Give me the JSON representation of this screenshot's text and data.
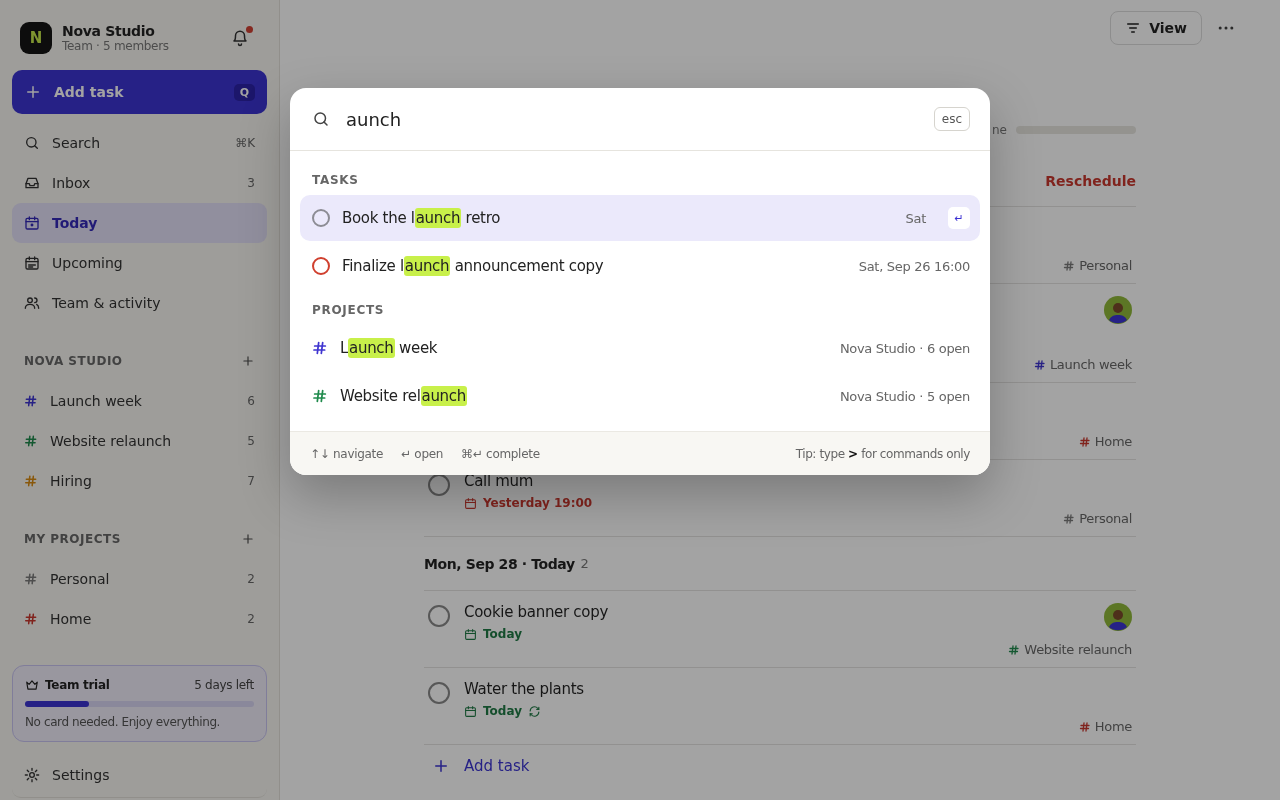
{
  "sidebar": {
    "workspace": {
      "logo": "N",
      "name": "Nova Studio",
      "subtitle": "Team · 5 members",
      "has_notification": true
    },
    "add_task": {
      "label": "Add task",
      "shortcut": "Q"
    },
    "nav": [
      {
        "kind": "search",
        "label": "Search",
        "badge": "⌘K",
        "selected": false
      },
      {
        "kind": "inbox",
        "label": "Inbox",
        "badge": "3",
        "selected": false
      },
      {
        "kind": "today",
        "label": "Today",
        "selected": true
      },
      {
        "kind": "upcoming",
        "label": "Upcoming",
        "selected": false
      },
      {
        "kind": "team",
        "label": "Team & activity",
        "selected": false
      }
    ],
    "sections": [
      {
        "title": "NOVA STUDIO",
        "projects": [
          {
            "name": "Launch week",
            "count": "6",
            "color": "#282285"
          },
          {
            "name": "Website relaunch",
            "count": "5",
            "color": "#145831"
          },
          {
            "name": "Hiring",
            "count": "7",
            "color": "#89580b"
          }
        ]
      },
      {
        "title": "MY PROJECTS",
        "projects": [
          {
            "name": "Personal",
            "count": "2",
            "color": "#4e4e4e"
          },
          {
            "name": "Home",
            "count": "2",
            "color": "#80231d"
          }
        ]
      }
    ],
    "trial": {
      "title": "Team trial",
      "remaining": "5 days left",
      "level": 0.28,
      "note": "No card needed. Enjoy everything."
    },
    "settings": {
      "label": "Settings"
    }
  },
  "main": {
    "view_button": "View",
    "progress": {
      "label": "ne",
      "level": 0
    },
    "groups": [
      {
        "action": "Reschedule",
        "tasks": [
          {
            "tag": "Personal",
            "color": "#4e4e4e"
          },
          {
            "avatar": true,
            "tag": "Launch week",
            "color": "#282285"
          },
          {
            "tag": "Home",
            "color": "#80231d"
          },
          {
            "title": "Call mum",
            "checked": false,
            "due": "Yesterday 19:00",
            "overdue": true,
            "tag": "Personal",
            "color": "#4e4e4e"
          }
        ]
      },
      {
        "title": "Mon, Sep 28 · Today",
        "count": "2",
        "tasks": [
          {
            "title": "Cookie banner copy",
            "checked": false,
            "due": "Today",
            "overdue": false,
            "avatar": true,
            "tag": "Website relaunch",
            "color": "#145831"
          },
          {
            "title": "Water the plants",
            "checked": false,
            "due": "Today",
            "overdue": false,
            "recurring": true,
            "tag": "Home",
            "color": "#80231d"
          }
        ]
      }
    ],
    "add_task": "Add task"
  },
  "palette": {
    "query": "aunch",
    "esc": "esc",
    "groups": [
      {
        "title": "TASKS",
        "items": [
          {
            "kind": "task",
            "before": "Book the l",
            "match": "aunch",
            "after": " retro",
            "meta": "Sat",
            "key": "↵",
            "selected": true,
            "color": "#8c8c94"
          },
          {
            "kind": "task",
            "before": "Finalize l",
            "match": "aunch",
            "after": " announcement copy",
            "meta": "Sat, Sep 26 16:00",
            "selected": false,
            "color": "#d0402f"
          }
        ]
      },
      {
        "title": "PROJECTS",
        "items": [
          {
            "kind": "project",
            "before": "L",
            "match": "aunch",
            "after": " week",
            "meta": "Nova Studio · 6 open",
            "selected": false,
            "color": "#3f35d0"
          },
          {
            "kind": "project",
            "before": "Website rel",
            "match": "aunch",
            "meta": "Nova Studio · 5 open",
            "selected": false,
            "color": "#1f8a4c"
          }
        ]
      }
    ],
    "hints": [
      "↑↓ navigate",
      "↵ open",
      "⌘↵ complete"
    ],
    "tip": "Tip: type **>** for commands only"
  }
}
